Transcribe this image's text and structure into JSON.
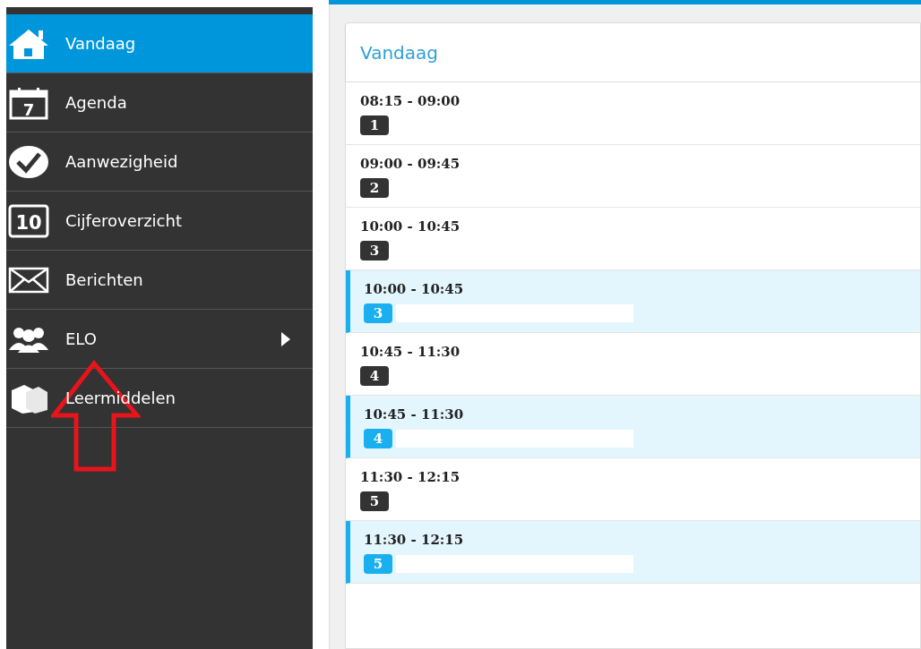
{
  "sidebar": {
    "items": [
      {
        "label": "Vandaag",
        "selected": true,
        "submenu": false
      },
      {
        "icon_text": "7",
        "label": "Agenda",
        "selected": false,
        "submenu": false
      },
      {
        "label": "Aanwezigheid",
        "selected": false,
        "submenu": false
      },
      {
        "icon_text": "10",
        "label": "Cijferoverzicht",
        "selected": false,
        "submenu": false
      },
      {
        "label": "Berichten",
        "selected": false,
        "submenu": false
      },
      {
        "label": "ELO",
        "selected": false,
        "submenu": true
      },
      {
        "label": "Leermiddelen",
        "selected": false,
        "submenu": false
      }
    ]
  },
  "panel": {
    "title": "Vandaag",
    "rows": [
      {
        "time": "08:15 - 09:00",
        "hour": "1",
        "highlighted": false
      },
      {
        "time": "09:00 - 09:45",
        "hour": "2",
        "highlighted": false
      },
      {
        "time": "10:00 - 10:45",
        "hour": "3",
        "highlighted": false
      },
      {
        "time": "10:00 - 10:45",
        "hour": "3",
        "highlighted": true
      },
      {
        "time": "10:45 - 11:30",
        "hour": "4",
        "highlighted": false
      },
      {
        "time": "10:45 - 11:30",
        "hour": "4",
        "highlighted": true
      },
      {
        "time": "11:30 - 12:15",
        "hour": "5",
        "highlighted": false
      },
      {
        "time": "11:30 - 12:15",
        "hour": "5",
        "highlighted": true
      }
    ]
  }
}
